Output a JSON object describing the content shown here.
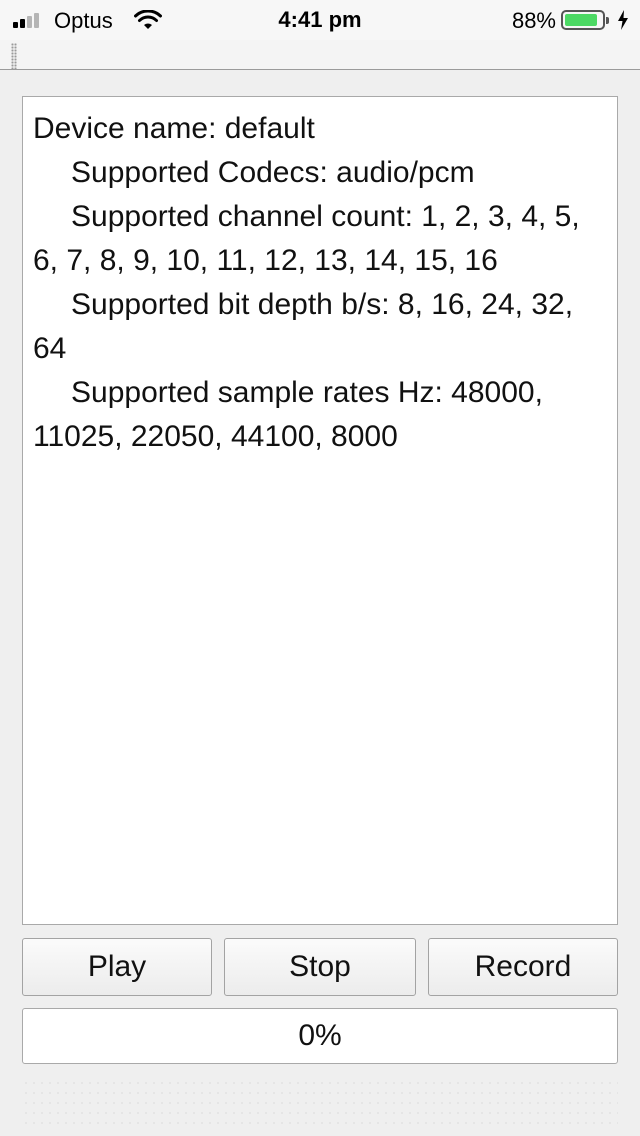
{
  "status_bar": {
    "carrier": "Optus",
    "time": "4:41 pm",
    "battery_percent": "88%",
    "battery_level": 0.88,
    "signal_bars_active": 2,
    "signal_bars_total": 4,
    "icons": {
      "signal": "cellular-signal-icon",
      "wifi": "wifi-icon",
      "battery": "battery-icon",
      "charging": "charging-bolt-icon"
    },
    "colors": {
      "battery_fill": "#4cd964"
    }
  },
  "device_info": {
    "device_name": "Device name: default",
    "codecs": "Supported Codecs: audio/pcm",
    "channel_count": "Supported channel count: 1, 2, 3, 4, 5, 6, 7, 8, 9, 10, 11, 12, 13, 14, 15, 16",
    "bit_depth": "Supported bit depth b/s: 8, 16, 24, 32, 64",
    "sample_rates": "Supported sample rates Hz: 48000, 11025, 22050, 44100, 8000"
  },
  "controls": {
    "play_label": "Play",
    "stop_label": "Stop",
    "record_label": "Record"
  },
  "progress": {
    "value": 0,
    "text": "0%"
  }
}
